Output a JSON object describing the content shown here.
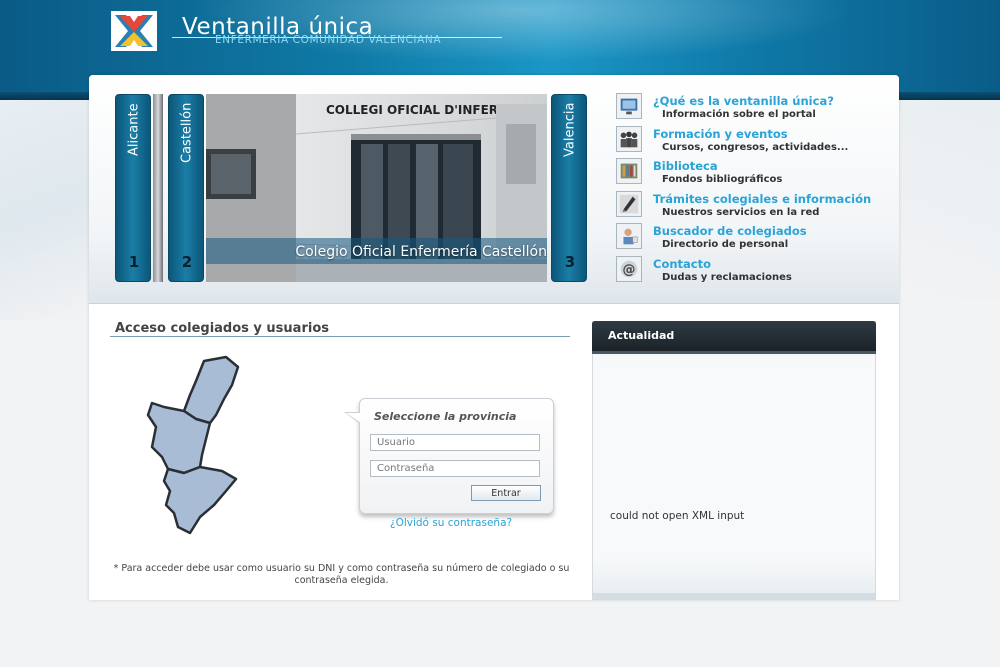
{
  "header": {
    "title": "Ventanilla única",
    "subtitle": "ENFERMERIA COMUNIDAD VALENCIANA"
  },
  "slider": {
    "tabs": [
      {
        "label": "Alicante",
        "number": "1"
      },
      {
        "label": "Castellón",
        "number": "2"
      },
      {
        "label": "Valencia",
        "number": "3"
      }
    ],
    "building_sign": "COLLEGI OFICIAL D'INFERMERIA",
    "caption": "Colegio Oficial Enfermería Castellón"
  },
  "nav": {
    "items": [
      {
        "title": "¿Qué es la ventanilla única?",
        "subtitle": "Información sobre el portal",
        "icon": "monitor-icon"
      },
      {
        "title": "Formación y eventos",
        "subtitle": "Cursos, congresos, actividades...",
        "icon": "people-icon"
      },
      {
        "title": "Biblioteca",
        "subtitle": "Fondos bibliográficos",
        "icon": "books-icon"
      },
      {
        "title": "Trámites colegiales e información",
        "subtitle": "Nuestros servicios en la red",
        "icon": "pen-icon"
      },
      {
        "title": "Buscador de colegiados",
        "subtitle": "Directorio de personal",
        "icon": "user-search-icon"
      },
      {
        "title": "Contacto",
        "subtitle": "Dudas y reclamaciones",
        "icon": "at-icon"
      }
    ]
  },
  "login": {
    "heading": "Acceso colegiados y usuarios",
    "box_title": "Seleccione la provincia",
    "username_placeholder": "Usuario",
    "password_placeholder": "Contraseña",
    "submit_label": "Entrar",
    "forgot_label": "¿Olvidó su contraseña?",
    "footnote": "* Para acceder debe usar como usuario su DNI y como contraseña su número de colegiado o su contraseña elegida."
  },
  "news": {
    "title": "Actualidad",
    "message": "could not open XML input"
  },
  "colors": {
    "header_blue": "#0f7aa6",
    "link_blue": "#2aa3d6",
    "tab_blue": "#1a7ea6",
    "news_header": "#1b2329",
    "map_fill": "#a9bcd6"
  }
}
